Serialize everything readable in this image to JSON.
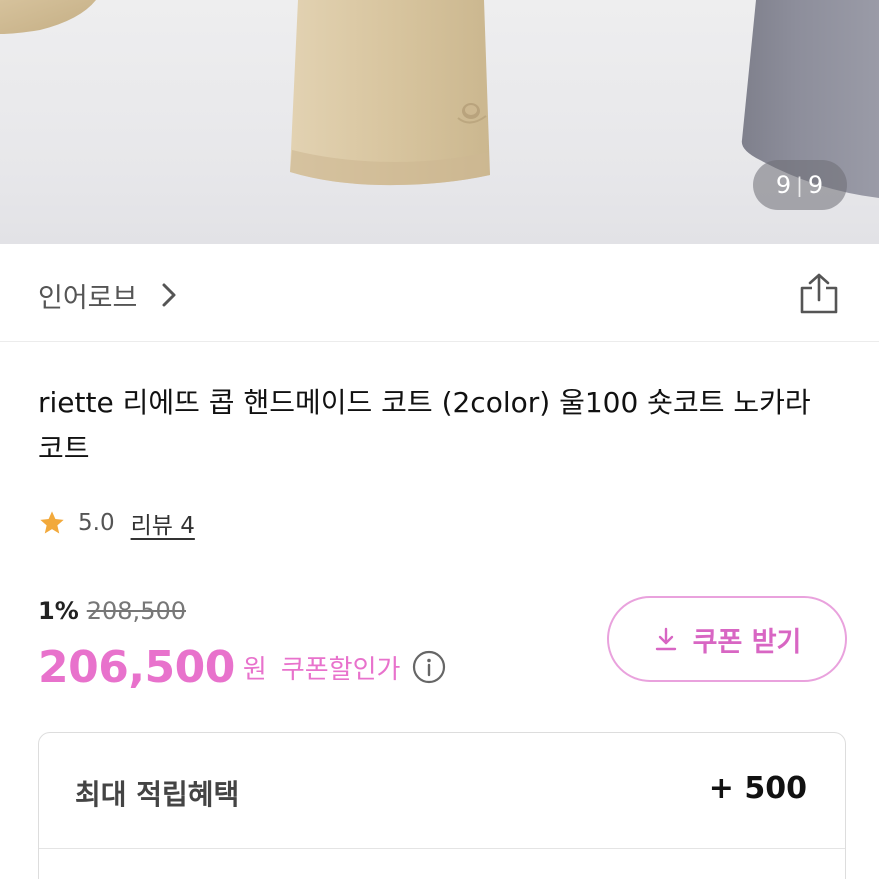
{
  "gallery": {
    "counter_current": "9",
    "counter_total": "9"
  },
  "store": {
    "name": "인어로브"
  },
  "product": {
    "title": "riette 리에뜨 콥 핸드메이드 코트 (2color) 울100 숏코트 노카라 코트"
  },
  "rating": {
    "score": "5.0",
    "review_label": "리뷰 4"
  },
  "price": {
    "discount_percent": "1%",
    "original_price": "208,500",
    "sale_price": "206,500",
    "currency": "원",
    "coupon_price_label": "쿠폰할인가"
  },
  "coupon_button": {
    "label": "쿠폰 받기"
  },
  "benefit": {
    "label": "최대 적립혜택",
    "value": "+ 500"
  },
  "colors": {
    "accent_pink": "#e872cc",
    "star": "#f2a93b",
    "coat_beige": "#d9c6a3",
    "coat_gray": "#8e8f9c"
  },
  "icons": {
    "store_chevron": "chevron-right-icon",
    "share": "share-icon",
    "star": "star-icon",
    "info": "info-icon",
    "download": "download-icon"
  }
}
